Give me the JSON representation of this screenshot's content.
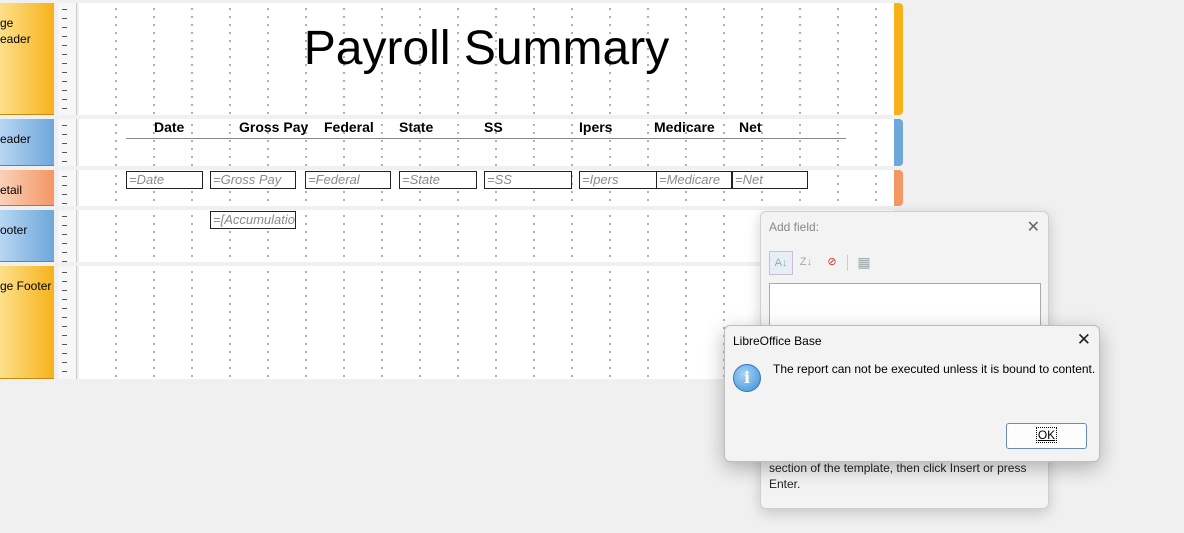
{
  "sections": {
    "page_header": "ge\neader",
    "group_header": "eader",
    "detail": "etail",
    "group_footer": "ooter",
    "page_footer": "ge Footer"
  },
  "report": {
    "title": "Payroll Summary",
    "columns": [
      "Date",
      "Gross Pay",
      "Federal",
      "State",
      "SS",
      "Ipers",
      "Medicare",
      "Net"
    ],
    "fields": [
      "=Date",
      "=Gross Pay",
      "=Federal",
      "=State",
      "=SS",
      "=Ipers",
      "=Medicare",
      "=Net"
    ],
    "footer_field": "=[Accumulatio"
  },
  "add_field": {
    "title": "Add field:",
    "close": "✕",
    "icons": [
      "sort-ascending-icon",
      "sort-descending-icon",
      "remove-sort-icon",
      "table-icon"
    ],
    "help_text": "section of the template, then click Insert or press Enter."
  },
  "dialog": {
    "title": "LibreOffice Base",
    "close": "✕",
    "icon": "i",
    "message": "The report can not be executed unless it is bound to content.",
    "ok": "OK"
  },
  "colors": {
    "orange": "#f7b21a",
    "blue": "#6ea7da",
    "salmon": "#f39765"
  }
}
